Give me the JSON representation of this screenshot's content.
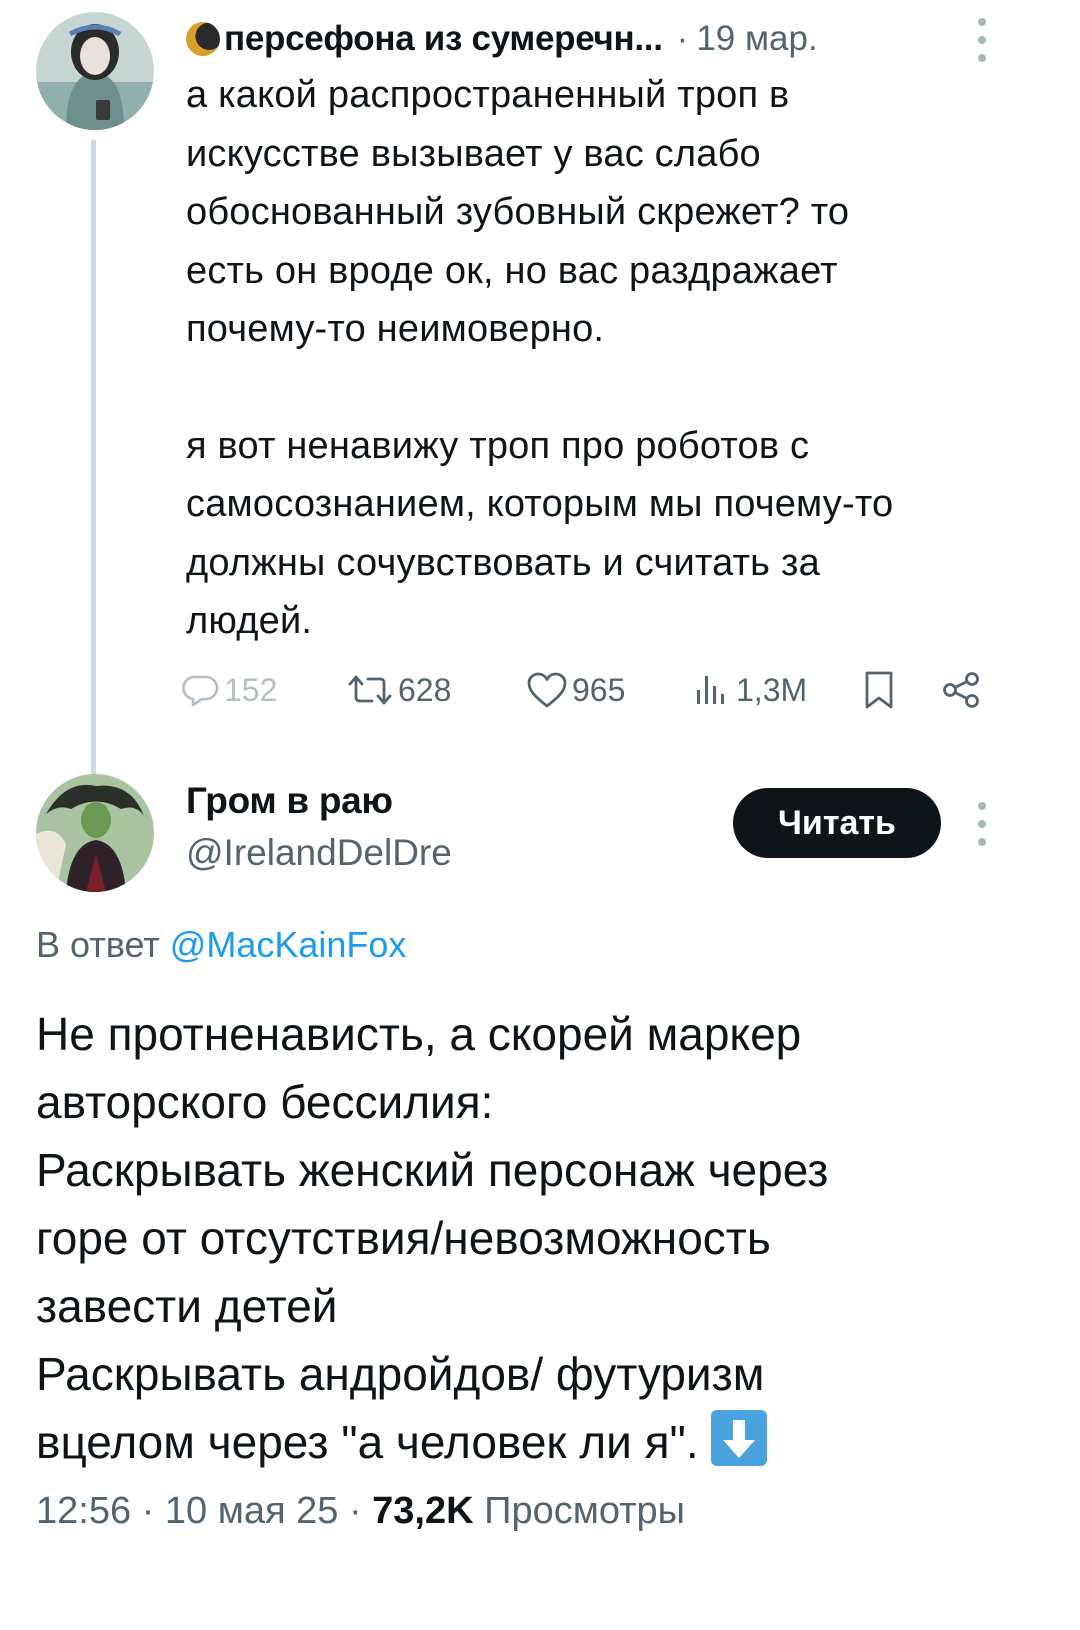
{
  "parent_tweet": {
    "author_name": "персефона из сумеречн...",
    "date": "19 мар.",
    "separator": "·",
    "paragraphs": [
      "а какой распространенный троп в искусстве вызывает у вас слабо обоснованный зубовный скрежет? то есть он вроде ок, но вас раздражает почему-то неимоверно.",
      "я вот ненавижу троп про роботов с самосознанием, которым мы почему-то должны сочувствовать и считать за людей."
    ],
    "lines": [
      [
        "а какой распространенный троп в",
        "искусстве вызывает у вас слабо",
        "обоснованный зубовный скрежет? то",
        "есть он вроде ок, но вас раздражает",
        "почему-то неимоверно."
      ],
      [
        "я вот ненавижу троп про роботов с",
        "самосознанием, которым мы почему-то",
        "должны сочувствовать и считать за",
        "людей."
      ]
    ],
    "stats": {
      "replies": "152",
      "reposts": "628",
      "likes": "965",
      "views": "1,3M"
    },
    "icons": [
      "moon-icon",
      "reply-icon",
      "repost-icon",
      "like-icon",
      "views-icon",
      "bookmark-icon",
      "share-icon",
      "more-icon"
    ]
  },
  "reply_tweet": {
    "author_name": "Гром в раю",
    "handle": "@IrelandDelDre",
    "follow_label": "Читать",
    "reply_to_prefix": "В ответ",
    "reply_to_mention": "@MacKainFox",
    "lines": [
      "Не протненависть, а скорей маркер",
      "авторского бессилия:",
      "Раскрывать женский персонаж через",
      "горе от отсутствия/невозможность",
      "завести детей",
      "Раскрывать андройдов/ футуризм",
      "вцелом через \"а человек ли я\"."
    ],
    "emoji": "down-arrow-emoji",
    "time": "12:56",
    "date": "10 мая 25",
    "separator": "·",
    "views_count": "73,2K",
    "views_label": "Просмотры"
  },
  "colors": {
    "text": "#0f1419",
    "secondary": "#536471",
    "link": "#1d9bf0",
    "thread_line": "#cfd9de",
    "button_bg": "#0f1419"
  }
}
